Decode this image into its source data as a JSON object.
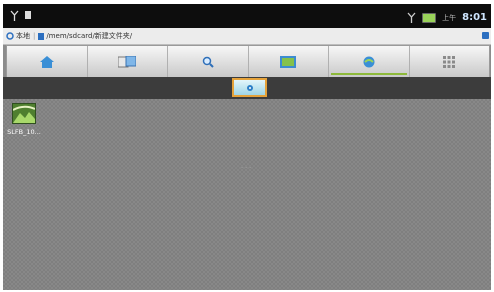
{
  "status_bar": {
    "ampm": "上午",
    "time": "8:01",
    "icons": [
      "antenna-icon",
      "usb-icon",
      "signal-icon",
      "battery-icon"
    ]
  },
  "path_bar": {
    "home_label": "本地",
    "path": "/mem/sdcard/新建文件夹/"
  },
  "toolbar": {
    "buttons": [
      "home-icon",
      "file-transfer-icon",
      "search-icon",
      "gallery-icon",
      "network-icon",
      "menu-grid-icon"
    ]
  },
  "files": [
    {
      "name": "SLFB_10...",
      "icon": "image-thumbnail-icon"
    }
  ],
  "center_label": "- - -",
  "colors": {
    "accent": "#e5a23a",
    "toolbar_green": "#8db93a",
    "background": "#888888"
  }
}
